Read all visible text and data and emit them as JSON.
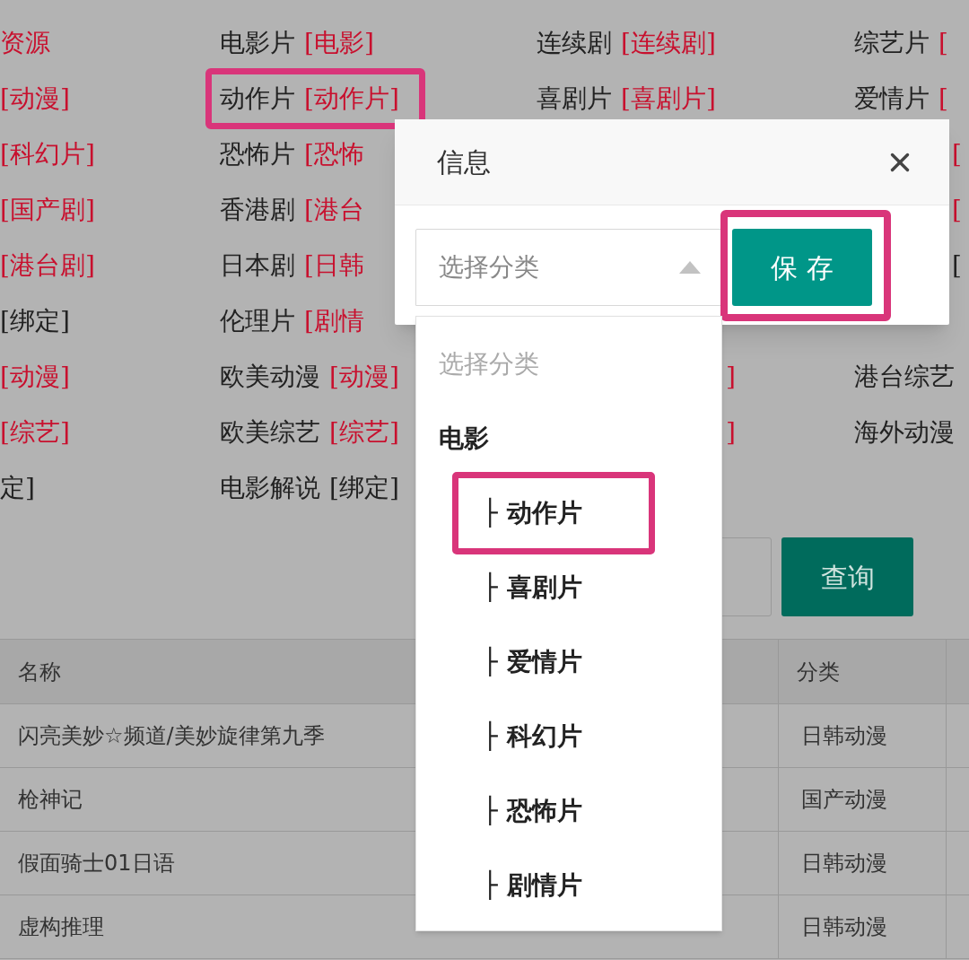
{
  "category_grid": {
    "rows": [
      {
        "cells": [
          {
            "tag": "资源",
            "tag_bound": false
          },
          {
            "name": "电影片",
            "tag": "[电影]",
            "tag_bound": false
          },
          {
            "name": "连续剧",
            "tag": "[连续剧]",
            "tag_bound": false
          },
          {
            "name": "综艺片",
            "tag": "[",
            "tag_bound": false
          }
        ]
      },
      {
        "cells": [
          {
            "tag": "[动漫]",
            "tag_bound": false
          },
          {
            "name": "动作片",
            "tag": "[动作片]",
            "tag_bound": false,
            "highlighted": true
          },
          {
            "name": "喜剧片",
            "tag": "[喜剧片]",
            "tag_bound": false
          },
          {
            "name": "爱情片",
            "tag": "[",
            "tag_bound": false
          }
        ]
      },
      {
        "cells": [
          {
            "tag": "[科幻片]",
            "tag_bound": false
          },
          {
            "name": "恐怖片",
            "tag": "[恐怖",
            "tag_bound": false
          },
          null,
          {
            "tag": "[",
            "tag_bound": false
          }
        ]
      },
      {
        "cells": [
          {
            "tag": "[国产剧]",
            "tag_bound": false
          },
          {
            "name": "香港剧",
            "tag": "[港台",
            "tag_bound": false
          },
          null,
          {
            "tag": "[",
            "tag_bound": false
          }
        ]
      },
      {
        "cells": [
          {
            "tag": "[港台剧]",
            "tag_bound": false
          },
          {
            "name": "日本剧",
            "tag": "[日韩",
            "tag_bound": false
          },
          null,
          {
            "tag": "[",
            "tag_bound": true
          }
        ]
      },
      {
        "cells": [
          {
            "tag": "[绑定]",
            "tag_bound": true
          },
          {
            "name": "伦理片",
            "tag": "[剧情",
            "tag_bound": false
          },
          null,
          null
        ]
      },
      {
        "cells": [
          {
            "tag": "[动漫]",
            "tag_bound": false
          },
          {
            "name": "欧美动漫",
            "tag": "[动漫]",
            "tag_bound": false
          },
          {
            "tag": "]",
            "tag_bound": false
          },
          {
            "name": "港台综艺"
          }
        ]
      },
      {
        "cells": [
          {
            "tag": "[综艺]",
            "tag_bound": false
          },
          {
            "name": "欧美综艺",
            "tag": "[综艺]",
            "tag_bound": false
          },
          {
            "tag": "]",
            "tag_bound": false
          },
          {
            "name": "海外动漫"
          }
        ]
      },
      {
        "cells": [
          {
            "tag": "定]",
            "tag_bound": true
          },
          {
            "name": "电影解说",
            "tag": "[绑定]",
            "tag_bound": true
          },
          null,
          null
        ]
      }
    ]
  },
  "search": {
    "button": "查询"
  },
  "table": {
    "columns": [
      "名称",
      "分类"
    ],
    "rows": [
      {
        "name": "闪亮美妙☆频道/美妙旋律第九季",
        "category": "日韩动漫"
      },
      {
        "name": "枪神记",
        "category": "国产动漫"
      },
      {
        "name": "假面骑士01日语",
        "category": "日韩动漫"
      },
      {
        "name": "虚构推理",
        "category": "日韩动漫"
      }
    ]
  },
  "dialog": {
    "title": "信息",
    "save_button": "保 存",
    "save_highlighted": true,
    "select": {
      "placeholder": "选择分类",
      "expanded": true,
      "options": [
        {
          "kind": "placeholder",
          "label": "选择分类"
        },
        {
          "kind": "group",
          "label": "电影",
          "children": [
            {
              "label": "├ 动作片",
              "highlighted": true
            },
            {
              "label": "├ 喜剧片",
              "highlighted": false
            },
            {
              "label": "├ 爱情片",
              "highlighted": false
            },
            {
              "label": "├ 科幻片",
              "highlighted": false
            },
            {
              "label": "├ 恐怖片",
              "highlighted": false
            },
            {
              "label": "├ 剧情片",
              "highlighted": false
            }
          ]
        }
      ]
    }
  }
}
